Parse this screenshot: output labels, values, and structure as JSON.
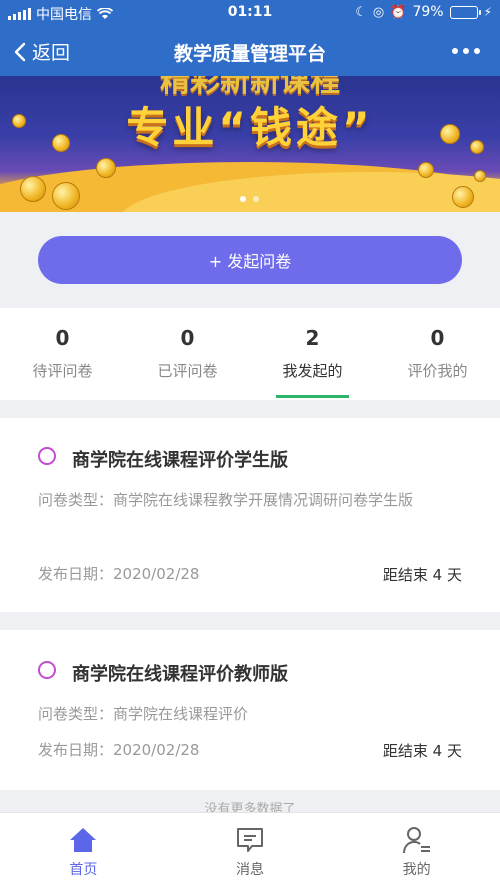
{
  "status_bar": {
    "carrier": "中国电信",
    "time": "01:11",
    "battery": "79%",
    "battery_level": 0.79
  },
  "nav": {
    "back_label": "返回",
    "title": "教学质量管理平台"
  },
  "banner": {
    "headline": "专业“钱途”",
    "top_text": "精彩新新课程"
  },
  "launch_button": {
    "label": "+ 发起问卷"
  },
  "stats": [
    {
      "count": "0",
      "label": "待评问卷"
    },
    {
      "count": "0",
      "label": "已评问卷"
    },
    {
      "count": "2",
      "label": "我发起的",
      "active": true
    },
    {
      "count": "0",
      "label": "评价我的"
    }
  ],
  "surveys": [
    {
      "title": "商学院在线课程评价学生版",
      "type_text": "问卷类型：商学院在线课程教学开展情况调研问卷学生版",
      "date_text": "发布日期：2020/02/28",
      "remaining": "距结束 4 天"
    },
    {
      "title": "商学院在线课程评价教师版",
      "type_text": "问卷类型：商学院在线课程评价",
      "date_text": "发布日期：2020/02/28",
      "remaining": "距结束 4 天"
    }
  ],
  "footer_note": "没有更多数据了",
  "tabbar": [
    {
      "label": "首页",
      "icon": "home-icon",
      "active": true
    },
    {
      "label": "消息",
      "icon": "message-icon"
    },
    {
      "label": "我的",
      "icon": "profile-icon"
    }
  ],
  "colors": {
    "primary": "#2f6ec8",
    "button": "#6f6cec",
    "active_underline": "#2cb46a",
    "ring": "#c34dcf",
    "tab_active": "#5b67e8"
  }
}
